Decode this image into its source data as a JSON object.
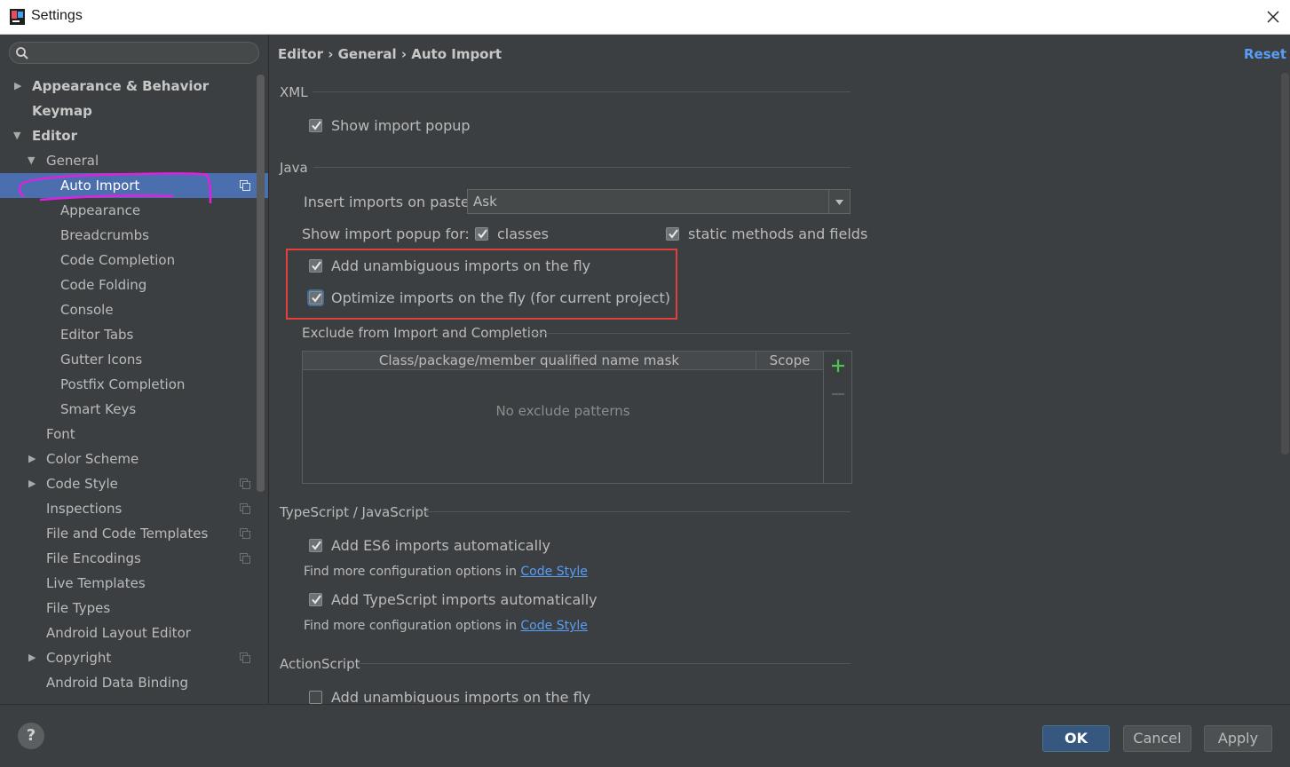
{
  "window": {
    "title": "Settings"
  },
  "sidebar": {
    "search_placeholder": "",
    "items": [
      {
        "label": "Appearance & Behavior"
      },
      {
        "label": "Keymap"
      },
      {
        "label": "Editor"
      },
      {
        "label": "General"
      },
      {
        "label": "Auto Import"
      },
      {
        "label": "Appearance"
      },
      {
        "label": "Breadcrumbs"
      },
      {
        "label": "Code Completion"
      },
      {
        "label": "Code Folding"
      },
      {
        "label": "Console"
      },
      {
        "label": "Editor Tabs"
      },
      {
        "label": "Gutter Icons"
      },
      {
        "label": "Postfix Completion"
      },
      {
        "label": "Smart Keys"
      },
      {
        "label": "Font"
      },
      {
        "label": "Color Scheme"
      },
      {
        "label": "Code Style"
      },
      {
        "label": "Inspections"
      },
      {
        "label": "File and Code Templates"
      },
      {
        "label": "File Encodings"
      },
      {
        "label": "Live Templates"
      },
      {
        "label": "File Types"
      },
      {
        "label": "Android Layout Editor"
      },
      {
        "label": "Copyright"
      },
      {
        "label": "Android Data Binding"
      }
    ],
    "selected": "Auto Import"
  },
  "content": {
    "breadcrumb": "Editor › General › Auto Import",
    "reset_label": "Reset",
    "xml": {
      "title": "XML",
      "show_import_popup": "Show import popup"
    },
    "java": {
      "title": "Java",
      "insert_imports_label": "Insert imports on paste:",
      "insert_imports_value": "Ask",
      "show_popup_for_label": "Show import popup for:",
      "classes_label": "classes",
      "static_label": "static methods and fields",
      "add_unambiguous": "Add unambiguous imports on the fly",
      "optimize_imports": "Optimize imports on the fly (for current project)",
      "exclude_title": "Exclude from Import and Completion",
      "table_columns": [
        "Class/package/member qualified name mask",
        "Scope"
      ],
      "table_empty": "No exclude patterns"
    },
    "typescript": {
      "title": "TypeScript / JavaScript",
      "add_es6": "Add ES6 imports automatically",
      "find_more_1": "Find more configuration options in ",
      "code_style_link_1": "Code Style",
      "add_ts": "Add TypeScript imports automatically",
      "find_more_2": "Find more configuration options in ",
      "code_style_link_2": "Code Style"
    },
    "actionscript": {
      "title": "ActionScript",
      "add_unambiguous": "Add unambiguous imports on the fly"
    }
  },
  "footer": {
    "help": "?",
    "ok": "OK",
    "cancel": "Cancel",
    "apply": "Apply"
  },
  "colors": {
    "background": "#3c3f41",
    "selection": "#4b6eaf",
    "link": "#589df6",
    "highlight_box": "#e2403b",
    "annotation": "#e020e0"
  }
}
